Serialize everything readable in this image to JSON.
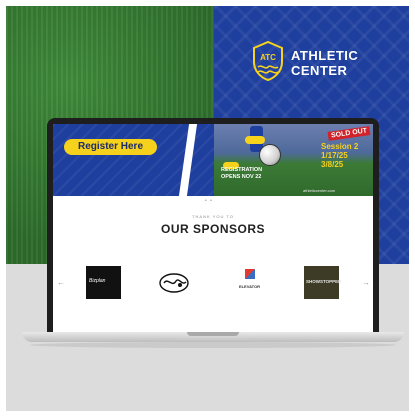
{
  "brand": {
    "line1": "ATHLETIC",
    "line2": "CENTER",
    "logo_letters": "ATC"
  },
  "hero": {
    "register_button": "Register Here",
    "badge": "SOLD OUT",
    "session_title": "Session 2",
    "session_dates": [
      "1/17/25",
      "3/8/25"
    ],
    "registration_line1": "REGISTRATION",
    "registration_line2": "OPENS NOV 22",
    "url": "athleticcenter.com"
  },
  "sponsors_section": {
    "eyebrow": "THANK YOU TO",
    "title": "OUR SPONSORS",
    "sponsors": [
      "Bizplan",
      "",
      "ELEVATOR",
      "SHOWSTOPPER"
    ]
  },
  "colors": {
    "accent_blue": "#1f3f9e",
    "accent_yellow": "#f7d21c",
    "grass": "#3f8a3a"
  }
}
